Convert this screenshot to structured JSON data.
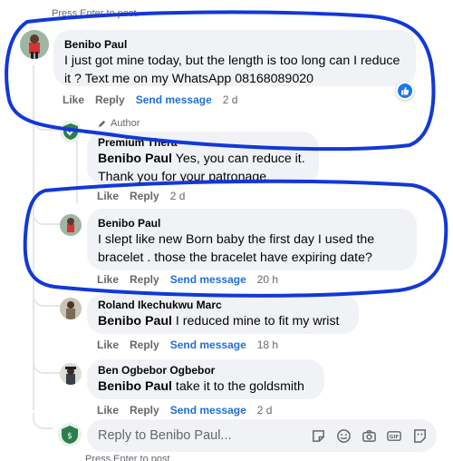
{
  "hints": {
    "top": "Press Enter to post.",
    "bottom": "Press Enter to post."
  },
  "comments": [
    {
      "author": "Benibo Paul",
      "mention": "",
      "text": "I just got mine today, but the length is too long can I reduce it ? Text me on my WhatsApp 08168089020",
      "actions": {
        "like": "Like",
        "reply": "Reply",
        "send": "Send message",
        "time": "2 d"
      },
      "reaction_icon": "like-reaction-icon"
    },
    {
      "badge": "Author",
      "author": "Premium Thera",
      "mention": "Benibo Paul",
      "text": " Yes, you can reduce it. Thank you for your patronage.",
      "actions": {
        "like": "Like",
        "reply": "Reply",
        "time": "2 d"
      }
    },
    {
      "author": "Benibo Paul",
      "mention": "",
      "text": "I slept like new Born baby the first day I used the bracelet . those the bracelet have expiring date?",
      "actions": {
        "like": "Like",
        "reply": "Reply",
        "send": "Send message",
        "time": "20 h"
      }
    },
    {
      "author": "Roland Ikechukwu Marc",
      "mention": "Benibo Paul",
      "text": " I reduced mine to fit my wrist",
      "actions": {
        "like": "Like",
        "reply": "Reply",
        "send": "Send message",
        "time": "18 h"
      }
    },
    {
      "author": "Ben Ogbebor Ogbebor",
      "mention": "Benibo Paul",
      "text": " take it to the goldsmith",
      "actions": {
        "like": "Like",
        "reply": "Reply",
        "send": "Send message",
        "time": "2 d"
      }
    }
  ],
  "reply_box": {
    "placeholder": "Reply to Benibo Paul...",
    "tools": [
      "sticker-icon",
      "emoji-icon",
      "camera-icon",
      "gif-icon",
      "sticker-square-icon"
    ]
  },
  "colors": {
    "link": "#216fdb",
    "bubble": "#f0f2f5",
    "muted": "#65676b",
    "annotation": "#1238d8",
    "like": "#1877f2"
  }
}
